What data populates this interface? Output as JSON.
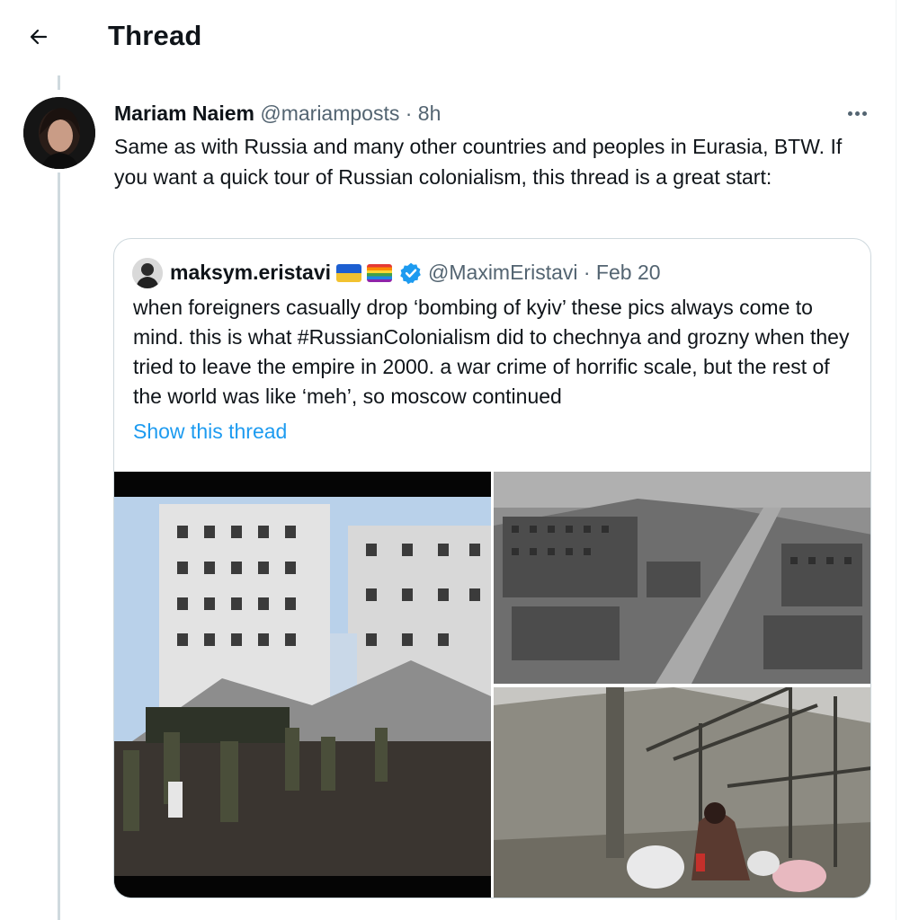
{
  "header": {
    "title": "Thread",
    "back_icon": "arrow-left-icon"
  },
  "tweet": {
    "display_name": "Mariam Naiem",
    "handle_time": "@mariamposts · 8h",
    "text": "Same as with Russia and many other countries and peoples in Eurasia, BTW. If you want a quick tour of Russian colonialism, this thread is a great start:",
    "more_icon": "more-horizontal-icon"
  },
  "quote": {
    "display_name": "maksym.eristavi",
    "flags": [
      "ukraine-flag-emoji",
      "rainbow-flag-emoji"
    ],
    "verified_icon": "verified-badge-icon",
    "handle_date": "@MaximEristavi · Feb 20",
    "text": "when foreigners casually drop ‘bombing of kyiv’ these pics always come to mind. this is what #RussianColonialism did to chechnya and grozny when they tried to leave the empire in 2000. a war crime of horrific scale, but the rest of the world was like ‘meh’, so moscow continued",
    "show_thread": "Show this thread"
  },
  "colors": {
    "text": "#0f1419",
    "secondary": "#536471",
    "link": "#1d9bf0",
    "border": "#cfd9de"
  }
}
